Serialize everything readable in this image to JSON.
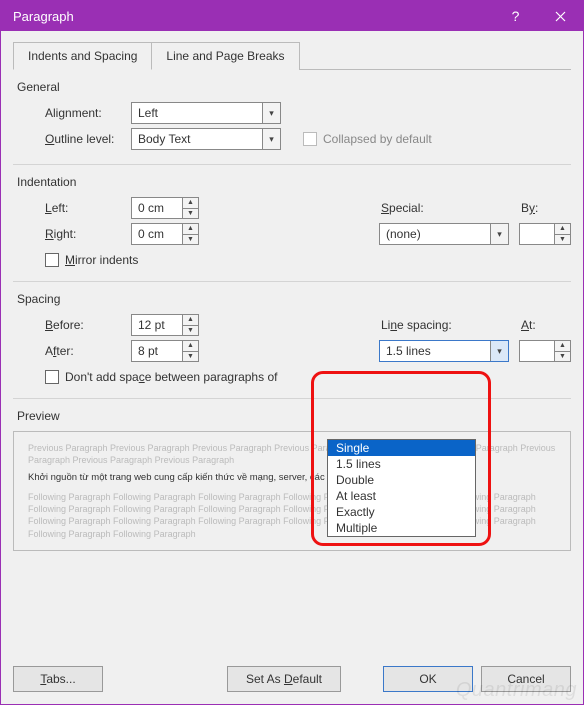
{
  "window": {
    "title": "Paragraph"
  },
  "tabs": {
    "spacing": "Indents and Spacing",
    "breaks": "Line and Page Breaks"
  },
  "general": {
    "heading": "General",
    "alignment_label": "Alignment:",
    "alignment_value": "Left",
    "outline_label": "Outline level:",
    "outline_value": "Body Text",
    "collapsed_label": "Collapsed by default"
  },
  "indentation": {
    "heading": "Indentation",
    "left_label": "Left:",
    "left_value": "0 cm",
    "right_label": "Right:",
    "right_value": "0 cm",
    "special_label": "Special:",
    "special_value": "(none)",
    "by_label": "By:",
    "by_value": "",
    "mirror_label": "Mirror indents"
  },
  "spacing": {
    "heading": "Spacing",
    "before_label": "Before:",
    "before_value": "12 pt",
    "after_label": "After:",
    "after_value": "8 pt",
    "linespacing_label": "Line spacing:",
    "linespacing_value": "1.5 lines",
    "at_label": "At:",
    "at_value": "",
    "dontadd_label": "Don't add space between paragraphs of",
    "options": [
      "Single",
      "1.5 lines",
      "Double",
      "At least",
      "Exactly",
      "Multiple"
    ]
  },
  "preview": {
    "heading": "Preview",
    "ghost_prev": "Previous Paragraph Previous Paragraph Previous Paragraph Previous Paragraph Previous Paragraph Previous Paragraph Previous Paragraph Previous Paragraph Previous Paragraph",
    "sample": "Khởi nguồn từ một trang web cung cấp kiến thức về mạng, server, các thiết bị mạng, thủ thuật máy tính.",
    "ghost_next": "Following Paragraph Following Paragraph Following Paragraph Following Paragraph Following Paragraph Following Paragraph Following Paragraph Following Paragraph Following Paragraph Following Paragraph Following Paragraph Following Paragraph Following Paragraph Following Paragraph Following Paragraph Following Paragraph Following Paragraph Following Paragraph Following Paragraph Following Paragraph"
  },
  "buttons": {
    "tabs": "Tabs...",
    "default": "Set As Default",
    "ok": "OK",
    "cancel": "Cancel"
  },
  "watermark": "Quantrimang"
}
